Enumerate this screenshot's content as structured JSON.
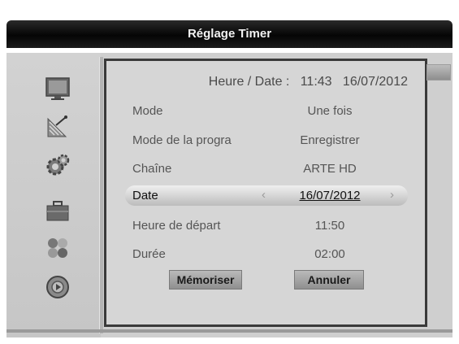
{
  "window": {
    "title": "Réglage Timer"
  },
  "sidebar": {
    "icons": [
      "tv-icon",
      "satellite-dish-icon",
      "settings-gear-icon",
      "briefcase-icon",
      "color-dots-icon",
      "media-disc-icon"
    ]
  },
  "header": {
    "label": "Heure / Date :",
    "time": "11:43",
    "date": "16/07/2012"
  },
  "rows": [
    {
      "label": "Mode",
      "value": "Une fois"
    },
    {
      "label": "Mode de la progra",
      "value": "Enregistrer"
    },
    {
      "label": "Chaîne",
      "value": "ARTE HD"
    },
    {
      "label": "Date",
      "value": "16/07/2012"
    },
    {
      "label": "Heure de départ",
      "value": "11:50"
    },
    {
      "label": "Durée",
      "value": "02:00"
    }
  ],
  "selected_row": "Date",
  "arrows": {
    "left": "‹",
    "right": "›"
  },
  "buttons": {
    "save": "Mémoriser",
    "cancel": "Annuler"
  }
}
